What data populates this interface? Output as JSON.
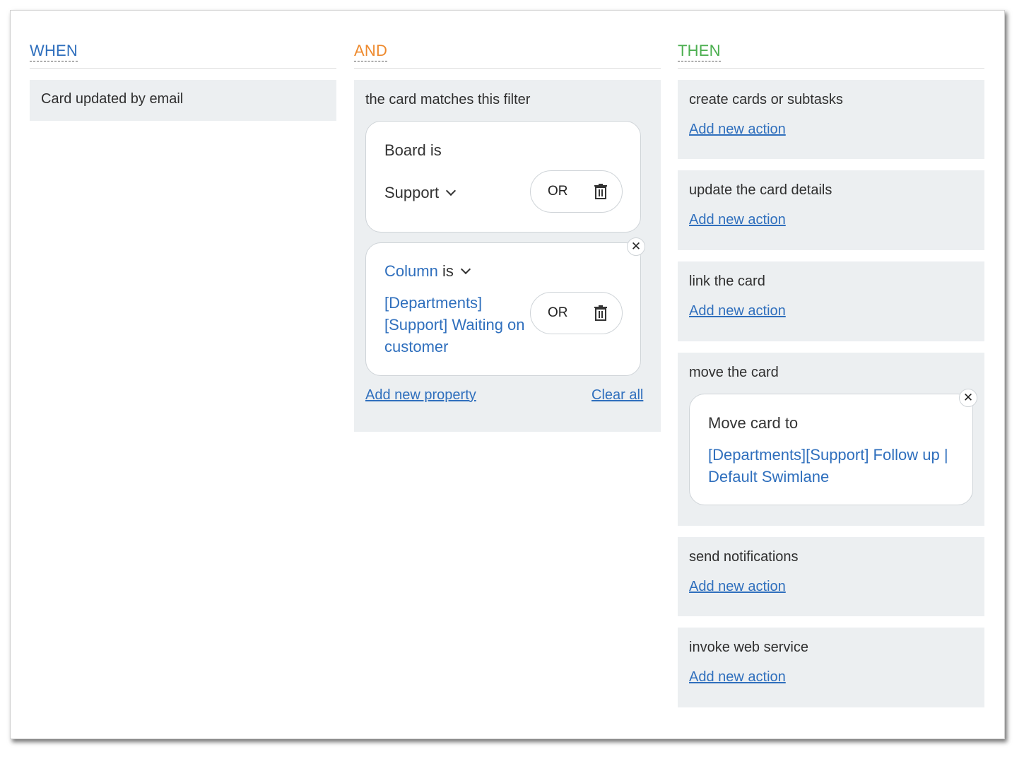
{
  "when": {
    "title": "WHEN",
    "trigger": "Card updated by email"
  },
  "and": {
    "title": "AND",
    "panel_title": "the card matches this filter",
    "filters": [
      {
        "property": "Board",
        "operator": "is",
        "value": "Support",
        "or_label": "OR"
      },
      {
        "property": "Column",
        "operator": "is",
        "value": "[Departments] [Support] Waiting on customer",
        "or_label": "OR"
      }
    ],
    "add_property": "Add new property",
    "clear_all": "Clear all"
  },
  "then": {
    "title": "THEN",
    "add_action": "Add new action",
    "actions": [
      {
        "title": "create cards or subtasks"
      },
      {
        "title": "update the card details"
      },
      {
        "title": "link the card"
      },
      {
        "title": "move the card",
        "detail_label": "Move card to",
        "detail_value": "[Departments][Support] Follow up | Default Swimlane"
      },
      {
        "title": "send notifications"
      },
      {
        "title": "invoke web service"
      }
    ]
  },
  "icons": {
    "close": "close-icon",
    "trash": "trash-icon",
    "chevron": "chevron-down-icon"
  },
  "colors": {
    "when": "#2f6fbd",
    "and": "#ee8a2e",
    "then": "#4caf50",
    "link": "#2f6fbd",
    "panel_bg": "#eceff1"
  }
}
